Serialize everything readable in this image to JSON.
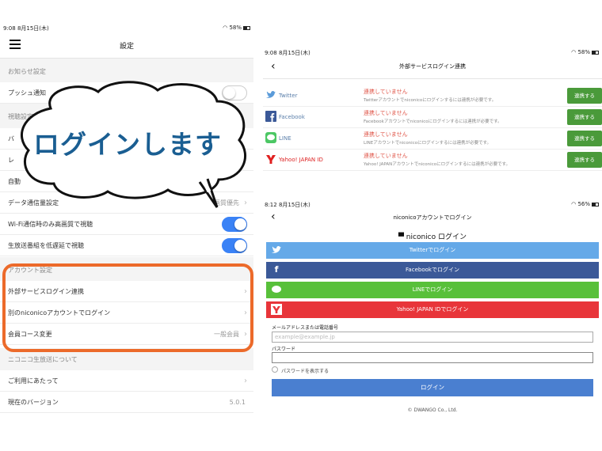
{
  "left": {
    "status_time": "9:08   8月15日(木)",
    "status_battery": "58%",
    "title": "設定",
    "sections": {
      "notice": "お知らせ設定",
      "viewing": "視聴設定",
      "account": "アカウント設定",
      "niconico_live": "ニコニコ生放送について"
    },
    "rows": {
      "push": "プッシュ通知",
      "video_r1": "バ",
      "video_r2": "レ",
      "video_r3": "自動",
      "data_saver": "データ通信量設定",
      "data_saver_value": "画質優先",
      "wifi_hq": "Wi-Fi通信時のみ高画質で視聴",
      "low_latency": "生放送番組を低遅延で視聴",
      "external_login": "外部サービスログイン連携",
      "other_account": "別のniconicoアカウントでログイン",
      "member_course": "会員コース変更",
      "member_course_value": "一般会員",
      "terms": "ご利用にあたって",
      "version": "現在のバージョン",
      "version_value": "5.0.1"
    },
    "bubble": {
      "text": "ログインします",
      "color": "#1a5e92"
    },
    "highlight_color": "#ec6a2a"
  },
  "right_top": {
    "status_time": "9:08   8月15日(木)",
    "status_battery": "58%",
    "title": "外部サービスログイン連携",
    "services": [
      {
        "icon": "twitter-icon",
        "name": "Twitter",
        "status": "連携していません",
        "desc": "Twitterアカウントでniconicoにログインするには連携が必要です。",
        "button": "連携する"
      },
      {
        "icon": "facebook-icon",
        "name": "Facebook",
        "status": "連携していません",
        "desc": "Facebookアカウントでniconicoにログインするには連携が必要です。",
        "button": "連携する"
      },
      {
        "icon": "line-icon",
        "name": "LINE",
        "status": "連携していません",
        "desc": "LINEアカウントでniconicoにログインするには連携が必要です。",
        "button": "連携する"
      },
      {
        "icon": "yahoo-icon",
        "name": "Yahoo! JAPAN ID",
        "status": "連携していません",
        "desc": "Yahoo! JAPANアカウントでniconicoにログインするには連携が必要です。",
        "button": "連携する"
      }
    ],
    "accent": "#4a9a3a"
  },
  "right_bottom": {
    "status_time": "8:12   8月15日(木)",
    "status_battery": "56%",
    "title": "niconicoアカウントでログイン",
    "logo": "niconico ログイン",
    "sns": {
      "twitter": "Twitterでログイン",
      "facebook": "Facebookでログイン",
      "line": "LINEでログイン",
      "yahoo": "Yahoo! JAPAN IDでログイン"
    },
    "email_label": "メールアドレスまたは電話番号",
    "email_placeholder": "example@example.jp",
    "password_label": "パスワード",
    "show_password": "パスワードを表示する",
    "login_button": "ログイン",
    "copyright": "© DWANGO Co., Ltd."
  }
}
